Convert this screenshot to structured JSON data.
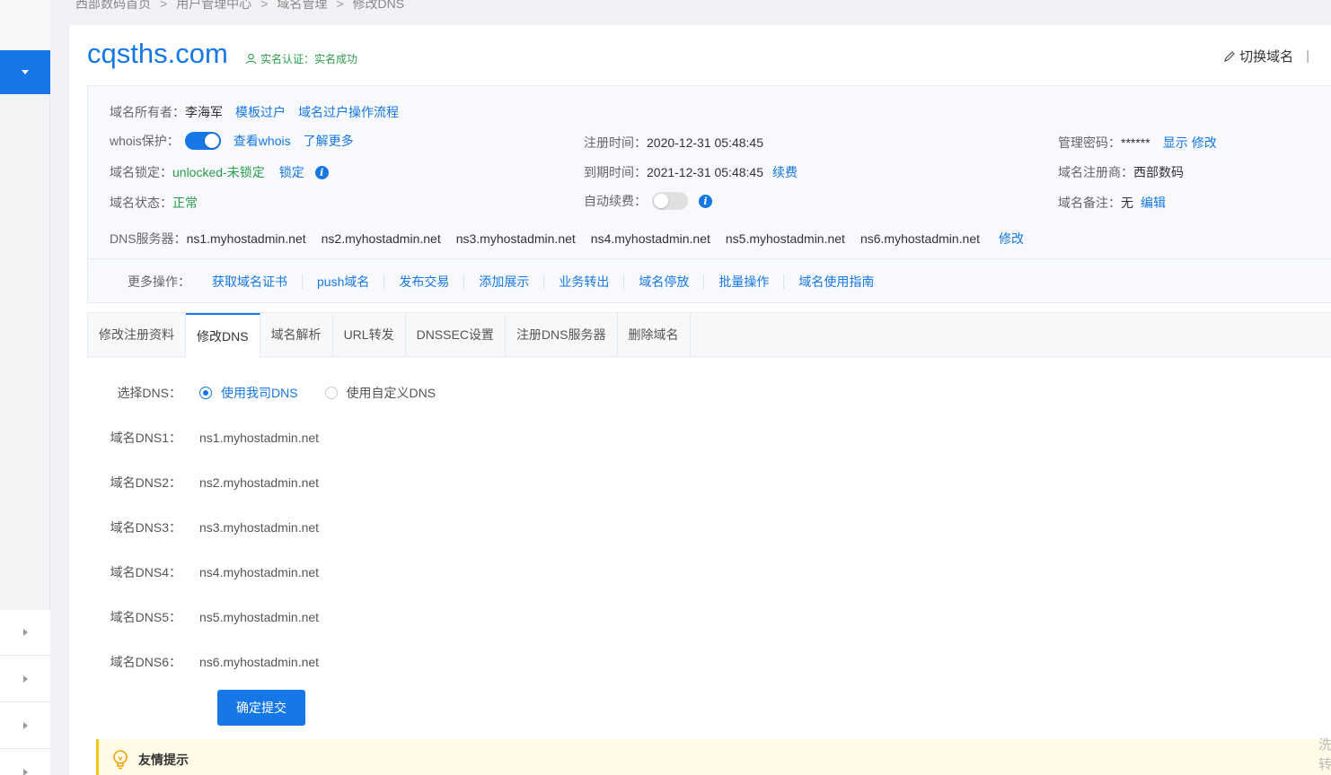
{
  "breadcrumb": [
    "西部数码首页",
    "用户管理中心",
    "域名管理",
    "修改DNS"
  ],
  "breadcrumb_sep": ">",
  "domain": {
    "name": "cqsths.com",
    "verify_label": "实名认证：",
    "verify_status": "实名成功",
    "switch_label": "切换域名",
    "switch_bar": "|"
  },
  "info": {
    "owner_label": "域名所有者：",
    "owner_value": "李海军",
    "owner_link1": "模板过户",
    "owner_link2": "域名过户操作流程",
    "whois_label": "whois保护：",
    "whois_link1": "查看whois",
    "whois_link2": "了解更多",
    "lock_label": "域名锁定：",
    "lock_value": "unlocked-未锁定",
    "lock_link": "锁定",
    "status_label": "域名状态：",
    "status_value": "正常",
    "reg_time_label": "注册时间：",
    "reg_time_value": "2020-12-31 05:48:45",
    "exp_time_label": "到期时间：",
    "exp_time_value": "2021-12-31 05:48:45",
    "renew_link": "续费",
    "auto_renew_label": "自动续费：",
    "pwd_label": "管理密码：",
    "pwd_value": "******",
    "pwd_show": "显示",
    "pwd_edit": "修改",
    "registrar_label": "域名注册商：",
    "registrar_value": "西部数码",
    "remark_label": "域名备注：",
    "remark_value": "无",
    "remark_edit": "编辑",
    "info_icon": "i",
    "dns_label": "DNS服务器：",
    "dns_servers": [
      "ns1.myhostadmin.net",
      "ns2.myhostadmin.net",
      "ns3.myhostadmin.net",
      "ns4.myhostadmin.net",
      "ns5.myhostadmin.net",
      "ns6.myhostadmin.net"
    ],
    "dns_edit": "修改"
  },
  "more_ops": {
    "label": "更多操作：",
    "items": [
      "获取域名证书",
      "push域名",
      "发布交易",
      "添加展示",
      "业务转出",
      "域名停放",
      "批量操作",
      "域名使用指南"
    ]
  },
  "tabs": [
    "修改注册资料",
    "修改DNS",
    "域名解析",
    "URL转发",
    "DNSSEC设置",
    "注册DNS服务器",
    "删除域名"
  ],
  "form": {
    "select_label": "选择DNS：",
    "option1": "使用我司DNS",
    "option2": "使用自定义DNS",
    "rows": [
      {
        "label": "域名DNS1：",
        "value": "ns1.myhostadmin.net"
      },
      {
        "label": "域名DNS2：",
        "value": "ns2.myhostadmin.net"
      },
      {
        "label": "域名DNS3：",
        "value": "ns3.myhostadmin.net"
      },
      {
        "label": "域名DNS4：",
        "value": "ns4.myhostadmin.net"
      },
      {
        "label": "域名DNS5：",
        "value": "ns5.myhostadmin.net"
      },
      {
        "label": "域名DNS6：",
        "value": "ns6.myhostadmin.net"
      }
    ],
    "submit": "确定提交"
  },
  "tip": {
    "title": "友情提示"
  },
  "edge_text": [
    "洗",
    "转"
  ],
  "icons": {
    "user": "user-icon",
    "edit": "pencil-icon",
    "info": "info-icon",
    "bulb": "lightbulb-icon"
  },
  "colors": {
    "accent": "#1677e6",
    "success": "#2a9d4a",
    "tip_bg": "#fffbe6"
  }
}
